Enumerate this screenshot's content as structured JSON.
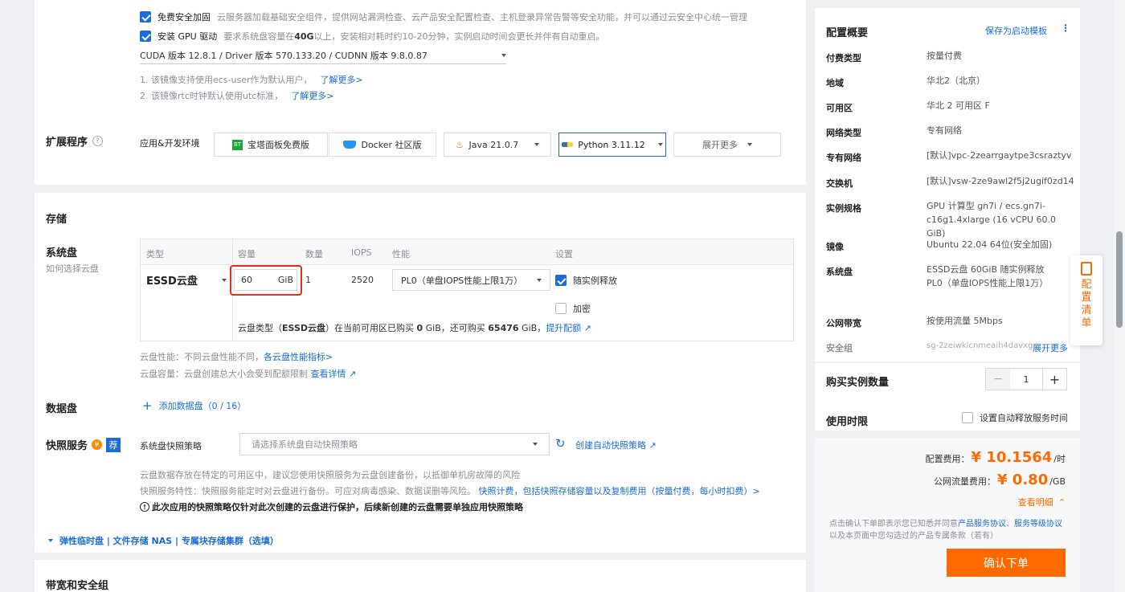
{
  "options": {
    "security": {
      "label": "免费安全加固",
      "desc": "云服务器加载基础安全组件，提供网站漏洞检查、云产品安全配置检查、主机登录异常告警等安全功能，并可以通过云安全中心统一管理",
      "checked": true
    },
    "gpu_driver": {
      "label": "安装 GPU 驱动",
      "desc_a": "要求系统盘容量在",
      "desc_b": "40G",
      "desc_c": "以上，安装相对耗时约10-20分钟，实例启动时间会更长并伴有自动重启。",
      "checked": true
    },
    "cuda_select": "CUDA 版本 12.8.1 / Driver 版本 570.133.20 / CUDNN 版本 9.8.0.87",
    "note1": "1. 该镜像支持使用ecs-user作为默认用户，",
    "note2": "2. 该镜像rtc时钟默认使用utc标准，",
    "learn_more": "了解更多>"
  },
  "extensions": {
    "title": "扩展程序",
    "env_label": "应用&开发环境",
    "items": [
      "宝塔面板免费版",
      "Docker 社区版",
      "Java 21.0.7",
      "Python 3.11.12",
      "展开更多"
    ],
    "bt_icon_text": "BT"
  },
  "storage": {
    "section_title": "存储",
    "system_disk": "系统盘",
    "how_choose": "如何选择云盘",
    "headers": [
      "类型",
      "容量",
      "数量",
      "IOPS",
      "性能",
      "设置"
    ],
    "disk_type": "ESSD云盘",
    "capacity": "60",
    "unit": "GiB",
    "quantity": "1",
    "iops": "2520",
    "performance": "PL0（单盘IOPS性能上限1万）",
    "release_with_instance": "随实例释放",
    "encrypt": "加密",
    "quota_a": "云盘类型（",
    "quota_b": "ESSD云盘",
    "quota_c": "）在当前可用区已购买 ",
    "quota_d": "0",
    "quota_e": " GiB，还可购买 ",
    "quota_f": "65476",
    "quota_g": " GiB，",
    "quota_link": "提升配额",
    "perf_note": "云盘性能：不同云盘性能不同，",
    "perf_link": "各云盘性能指标>",
    "cap_note": "云盘容量：云盘创建总大小会受到配额限制",
    "cap_link": "查看详情",
    "data_disk": "数据盘",
    "add_data_disk": "添加数据盘",
    "data_disk_count": "（0 / 16）"
  },
  "snapshot": {
    "title": "快照服务",
    "badge": "荐",
    "policy_label": "系统盘快照策略",
    "placeholder": "请选择系统盘自动快照策略",
    "create_link": "创建自动快照策略",
    "note1": "云盘数据存放在特定的可用区中，建议您使用快照服务为云盘创建备份，以抵御单机房故障的风险",
    "note2": "快照服务特性：快照服务能定时对云盘进行备份。可应对病毒感染、数据误删等风险。",
    "billing_link": "快照计费，包括快照存储容量以及复制费用（按量付费，每小时扣费）>",
    "warning": "此次应用的快照策略仅针对此次创建的云盘进行保护，后续新创建的云盘需要单独应用快照策略",
    "elastic": "弹性临时盘 | 文件存储 NAS | 专属块存储集群（选填）"
  },
  "bandwidth_title": "带宽和安全组",
  "summary": {
    "title": "配置概要",
    "save_template": "保存为启动模板",
    "rows": [
      {
        "label": "付费类型",
        "value": "按量付费"
      },
      {
        "label": "地域",
        "value": "华北2（北京）"
      },
      {
        "label": "可用区",
        "value": "华北 2 可用区 F"
      },
      {
        "label": "网络类型",
        "value": "专有网络"
      },
      {
        "label": "专有网络",
        "value": "[默认]vpc-2zearrgaytpe3csraztyv"
      },
      {
        "label": "交换机",
        "value": "[默认]vsw-2ze9awl2f5j2ugif0zd14"
      },
      {
        "label": "实例规格",
        "value": "GPU 计算型 gn7i / ecs.gn7i-c16g1.4xlarge (16 vCPU 60.0 GiB)"
      },
      {
        "label": "镜像",
        "value": "Ubuntu 22.04 64位(安全加固)"
      },
      {
        "label": "系统盘",
        "value": "ESSD云盘 60GiB 随实例释放 PL0（单盘IOPS性能上限1万）"
      },
      {
        "label": "公网带宽",
        "value": "按使用流量 5Mbps"
      },
      {
        "label": "安全组",
        "value": "sg-2zeiwklcnmeaih4davxg"
      }
    ],
    "expand_more": "展开更多",
    "float_tab": "配置清单"
  },
  "purchase": {
    "quantity_label": "购买实例数量",
    "quantity": "1",
    "minus": "−",
    "plus": "+",
    "duration_label": "使用时限",
    "auto_release": "设置自动释放服务时间",
    "config_fee_label": "配置费用：",
    "config_fee": "¥ 10.1564",
    "config_fee_unit": "/时",
    "traffic_fee_label": "公网流量费用：",
    "traffic_fee": "¥ 0.80",
    "traffic_fee_unit": "/GB",
    "details": "查看明细",
    "agree_a": "点击确认下单即表示您已知悉并同意",
    "agree_link1": "产品服务协议",
    "agree_sep": "、",
    "agree_link2": "服务等级协议",
    "agree_b": "以及本页面中您勾选过的产品专属条款（若有）",
    "confirm": "确认下单"
  },
  "colors": {
    "accent": "#1a6dd8",
    "orange": "#ff6a00",
    "highlight": "#e0301e"
  }
}
